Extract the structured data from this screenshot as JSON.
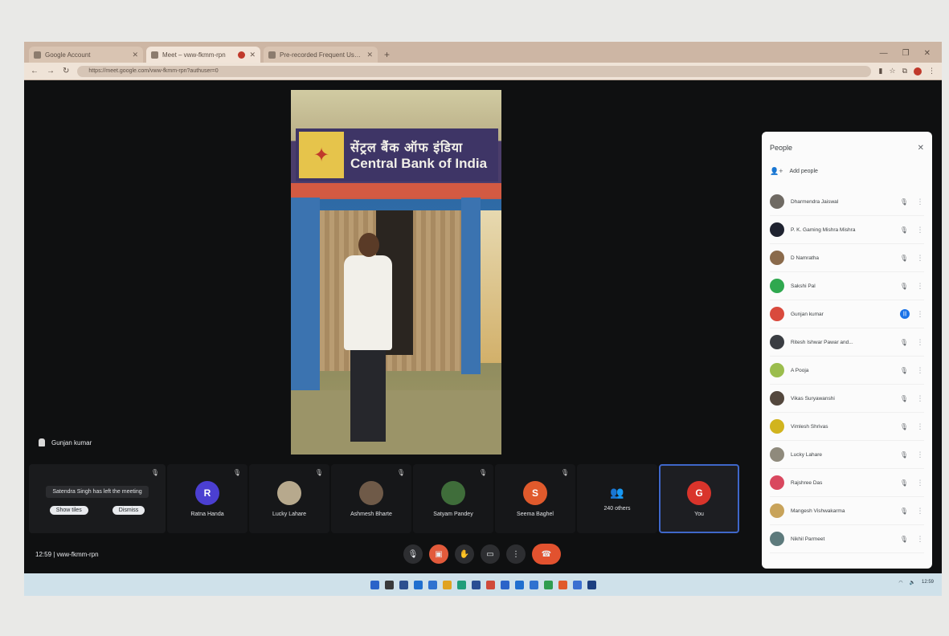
{
  "browser": {
    "tabs": [
      {
        "title": "Google Account",
        "active": false
      },
      {
        "title": "Meet – vww-fkmm-rpn",
        "active": true,
        "recording": true
      },
      {
        "title": "Pre-recorded Frequent Users",
        "active": false
      }
    ],
    "url": "https://meet.google.com/vww-fkmm-rpn?authuser=0"
  },
  "main_video": {
    "sign_hindi": "सेंट्रल बैंक ऑफ इंडिया",
    "sign_english": "Central Bank of India"
  },
  "self_tile": {
    "name": "Gunjan kumar"
  },
  "strip": {
    "toast_text": "Satendra Singh has left the meeting",
    "toast_buttons": [
      "Show tiles",
      "Dismiss"
    ],
    "tiles": [
      {
        "name": "Ratna Handa",
        "initial": "R",
        "color": "#4b3fd1"
      },
      {
        "name": "Lucky Lahare",
        "initial": "",
        "color": "#b7a98d"
      },
      {
        "name": "Ashmesh Bharte",
        "initial": "",
        "color": "#6f5a48"
      },
      {
        "name": "Satyam Pandey",
        "initial": "",
        "color": "#3f6d3a"
      },
      {
        "name": "Seema Baghel",
        "initial": "S",
        "color": "#e05a2c"
      }
    ],
    "others": {
      "count": "240 others"
    },
    "you": {
      "name": "You",
      "initial": "G",
      "color": "#d9342b"
    }
  },
  "controls": {
    "clock": "12:59 | vww-fkmm-rpn"
  },
  "people_panel": {
    "title": "People",
    "add_label": "Add people",
    "participants": [
      {
        "name": "Dharmendra Jaiswal",
        "color": "#6f6a63"
      },
      {
        "name": "P. K. Gaming Mishra Mishra",
        "color": "#1f2330"
      },
      {
        "name": "D Namratha",
        "color": "#8a6a4b"
      },
      {
        "name": "Sakshi Pal",
        "color": "#2fa84f"
      },
      {
        "name": "Gunjan kumar",
        "color": "#d94a3d",
        "speaking": true
      },
      {
        "name": "Ritesh Ishwar Pawar and...",
        "color": "#3a3d42"
      },
      {
        "name": "A Pooja",
        "color": "#9bbd4d"
      },
      {
        "name": "Vikas Suryawanshi",
        "color": "#53473d"
      },
      {
        "name": "Vimlesh Shrivas",
        "color": "#d1b41e"
      },
      {
        "name": "Lucky Lahare",
        "color": "#8f8a7c"
      },
      {
        "name": "Rajshree Das",
        "color": "#d9485f"
      },
      {
        "name": "Mangesh Vishwakarma",
        "color": "#c8a35a"
      },
      {
        "name": "Nikhil Parmeet",
        "color": "#5d7a7c"
      }
    ]
  },
  "taskbar": {
    "weather": "",
    "tray": "12:59"
  }
}
